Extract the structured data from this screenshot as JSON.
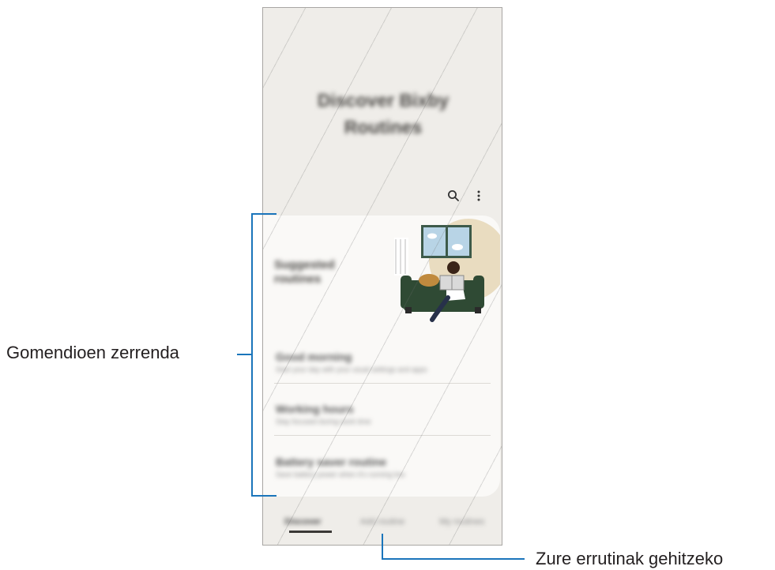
{
  "screen": {
    "title": "Discover Bixby Routines",
    "toolbar": {
      "search_icon": "search-icon",
      "more_icon": "more-vertical-icon"
    },
    "recommendation_card": {
      "heading": "Suggested routines",
      "illustration": "person-reading-on-sofa-illustration"
    },
    "recommendations": [
      {
        "title": "Good morning",
        "desc": "Start your day with your usual settings and apps"
      },
      {
        "title": "Working hours",
        "desc": "Stay focused during work time"
      },
      {
        "title": "Battery saver routine",
        "desc": "Save battery power when it's running low"
      }
    ],
    "tabs": [
      {
        "label": "Discover",
        "active": true
      },
      {
        "label": "Add routine",
        "active": false
      },
      {
        "label": "My routines",
        "active": false
      }
    ]
  },
  "callouts": {
    "recommendation_list": "Gomendioen zerrenda",
    "add_routines": "Zure errutinak gehitzeko"
  },
  "colors": {
    "callout_line": "#1a75bb",
    "screen_bg": "#efede9",
    "card_bg": "#faf9f7"
  }
}
